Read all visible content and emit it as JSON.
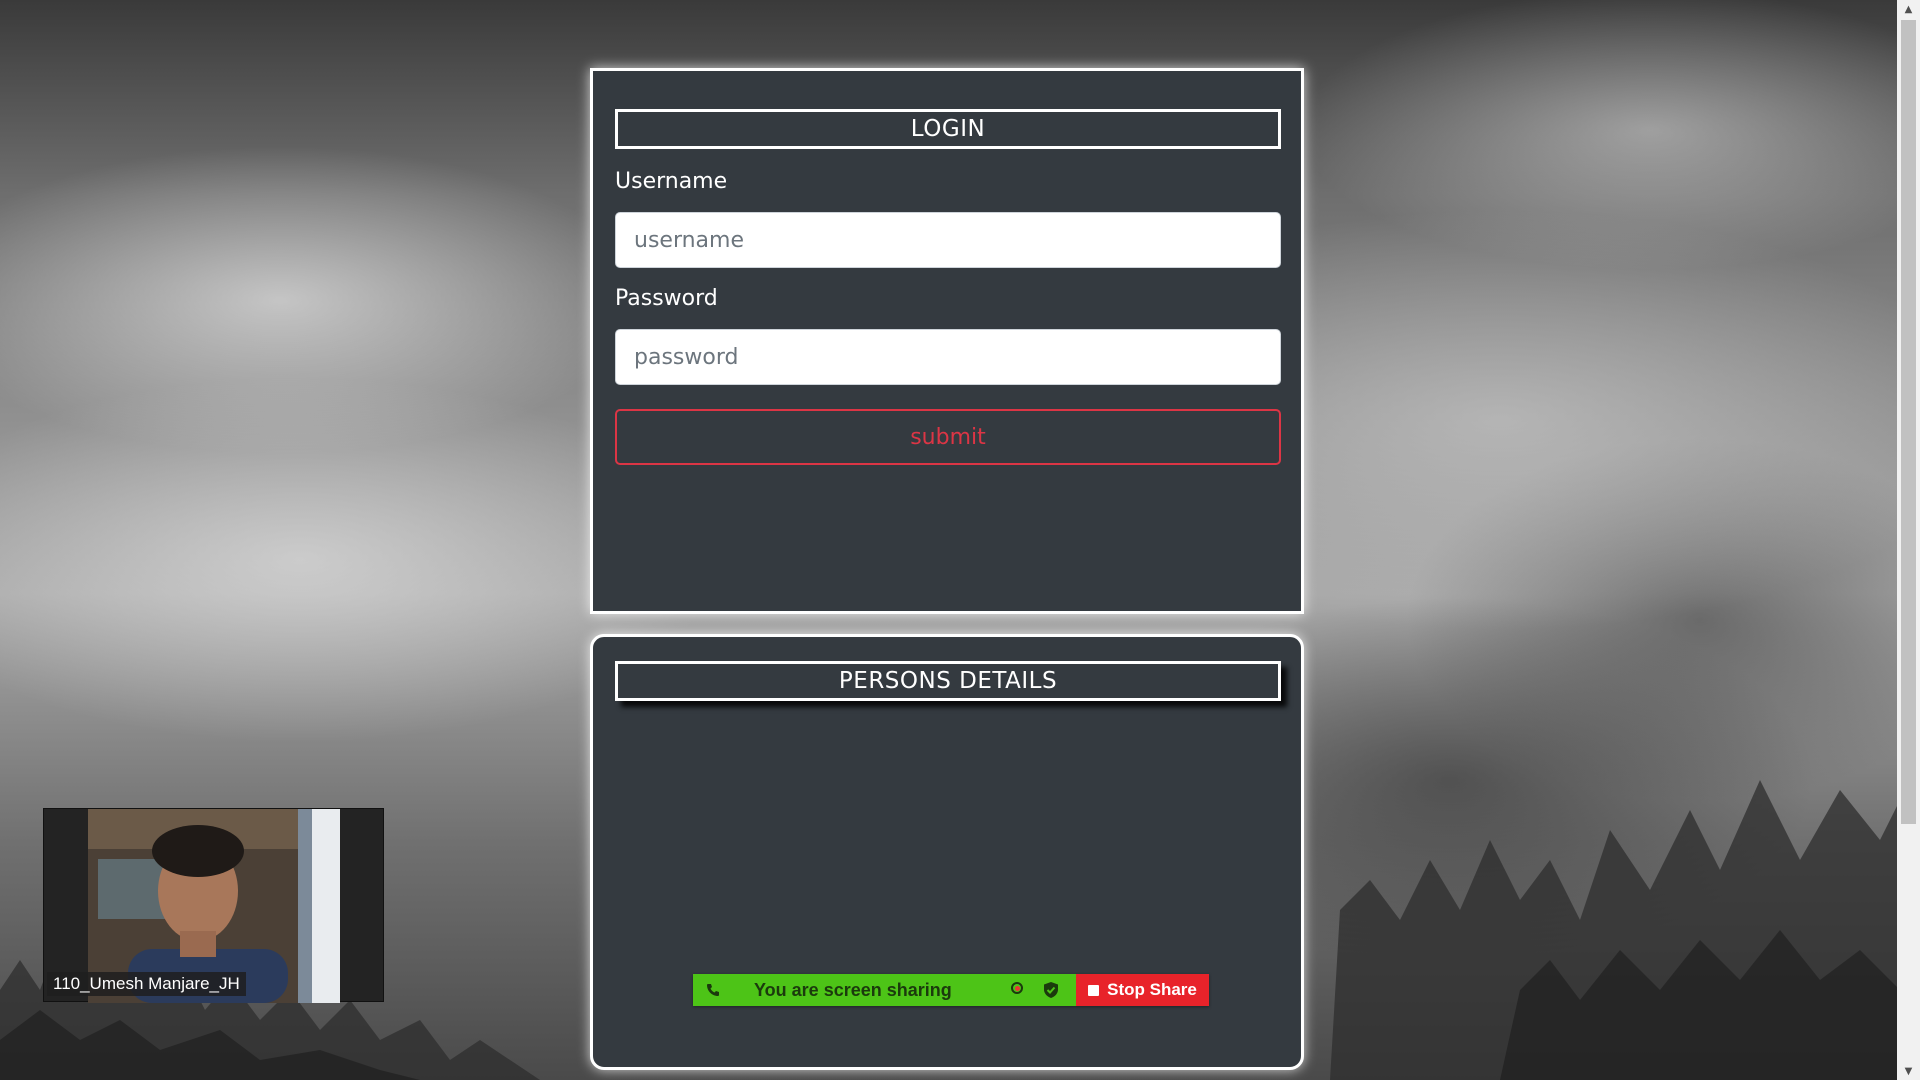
{
  "login": {
    "title": "LOGIN",
    "username_label": "Username",
    "username_placeholder": "username",
    "username_value": "",
    "password_label": "Password",
    "password_placeholder": "password",
    "password_value": "",
    "submit_label": "submit"
  },
  "persons": {
    "title": "PERSONS DETAILS"
  },
  "screen_share": {
    "status_text": "You are screen sharing",
    "stop_label": "Stop Share",
    "colors": {
      "bar": "#4dc417",
      "stop": "#e8232a"
    }
  },
  "video": {
    "participant_name": "110_Umesh Manjare_JH"
  },
  "colors": {
    "panel_bg": "#343a40",
    "danger": "#dc3545"
  },
  "icons": {
    "drag": "phone-drag-icon",
    "record": "record-icon",
    "security": "shield-check-icon",
    "stop": "stop-square-icon"
  }
}
